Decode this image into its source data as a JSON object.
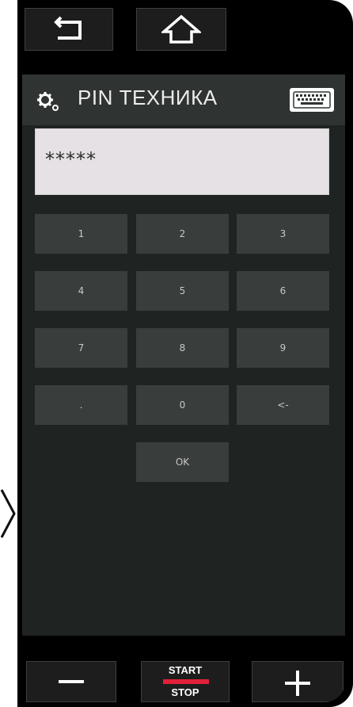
{
  "colors": {
    "screen_bg": "#1f2322",
    "titlebar_bg": "#2f3332",
    "key_bg": "#393d3c",
    "field_bg": "#e5e1e4",
    "accent_red": "#e0203a"
  },
  "topbar": {
    "back_icon": "back-arrow-icon",
    "home_icon": "home-icon"
  },
  "header": {
    "title": "PIN ТЕХНИКА",
    "settings_icon": "gears-icon",
    "keyboard_icon": "keyboard-icon"
  },
  "pin_input": {
    "value": "*****"
  },
  "keypad": {
    "keys": [
      "1",
      "2",
      "3",
      "4",
      "5",
      "6",
      "7",
      "8",
      "9",
      ".",
      "0",
      "<-"
    ],
    "ok_label": "OK"
  },
  "bottombar": {
    "minus_icon": "minus-icon",
    "start_label": "START",
    "stop_label": "STOP",
    "plus_icon": "plus-icon"
  }
}
